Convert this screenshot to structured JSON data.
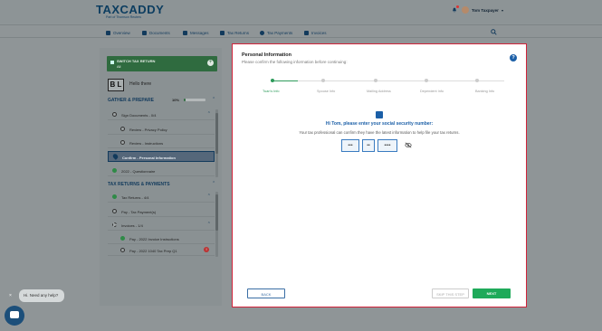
{
  "header": {
    "logo_main": "TAXCADDY",
    "logo_sub": "Part of Thomson Reuters",
    "user_name": "Tom Taxpayer"
  },
  "nav": {
    "items": [
      {
        "label": "Overview",
        "icon": "home-icon"
      },
      {
        "label": "Documents",
        "icon": "documents-icon"
      },
      {
        "label": "Messages",
        "icon": "messages-icon"
      },
      {
        "label": "Tax Returns",
        "icon": "tax-returns-icon"
      },
      {
        "label": "Tax Payments",
        "icon": "dollar-icon"
      },
      {
        "label": "Invoices",
        "icon": "invoice-icon"
      }
    ]
  },
  "sidebar": {
    "switch_title": "SWITCH TAX RETURN",
    "switch_value": "All",
    "bl_initials": "B L",
    "greeting": "Hello there",
    "gather_heading": "GATHER & PREPARE",
    "gather_progress_label": "10%",
    "gather_progress": 0.1,
    "gather_items": [
      {
        "label": "Sign Documents - 0/4",
        "state": "empty",
        "caret": "^"
      },
      {
        "label": "Review - Privacy Policy",
        "state": "empty",
        "caret": ""
      },
      {
        "label": "Review - Instructions",
        "state": "empty",
        "caret": ""
      },
      {
        "label": "Confirm - Personal Information",
        "state": "active",
        "caret": ""
      },
      {
        "label": "2022 - Questionnaire",
        "state": "done",
        "caret": ""
      }
    ],
    "returns_heading": "TAX RETURNS & PAYMENTS",
    "returns_items": [
      {
        "label": "Tax Returns - 4/4",
        "state": "done",
        "caret": "^"
      },
      {
        "label": "Pay - Tax Payment(s)",
        "state": "empty",
        "caret": ""
      },
      {
        "label": "Invoices - 1/4",
        "state": "partial",
        "caret": "^"
      },
      {
        "label": "Pay - 2022 Invoice Instructions",
        "state": "done",
        "caret": ""
      },
      {
        "label": "Pay - 2022 1040 Tax Prep Q1",
        "state": "empty",
        "caret": ""
      }
    ]
  },
  "chat": {
    "close": "×",
    "bubble": "Hi. Need any help?"
  },
  "modal": {
    "title": "Personal Information",
    "subtitle": "Please confirm the following information before continuing:",
    "help": "?",
    "steps": [
      {
        "label": "Tuan's Info",
        "active": true
      },
      {
        "label": "Spouse Info",
        "active": false
      },
      {
        "label": "Mailing Address",
        "active": false
      },
      {
        "label": "Dependent Info",
        "active": false
      },
      {
        "label": "Banking Info",
        "active": false
      }
    ],
    "ssn_heading": "Hi Tom, please enter your social security number:",
    "ssn_sub": "Your tax professional can confirm they have the latest information to help file your tax returns.",
    "ssn_parts": [
      "•••",
      "••",
      "••••"
    ],
    "back_label": "BACK",
    "skip_label": "SKIP THIS STEP",
    "next_label": "NEXT"
  },
  "colors": {
    "brand": "#0c3d60",
    "accent_green": "#1faa5a",
    "accent_blue": "#1b5fa7",
    "focus_border": "#d1233a"
  }
}
